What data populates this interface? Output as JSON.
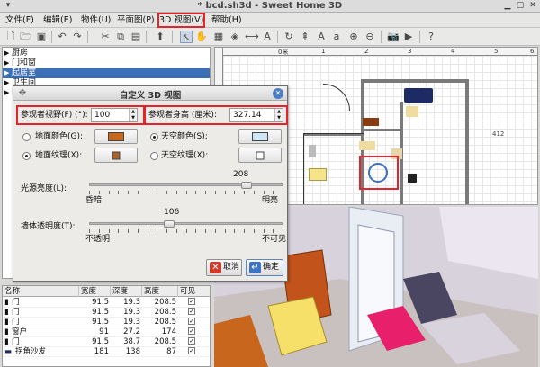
{
  "window": {
    "title": "* bcd.sh3d - Sweet Home 3D"
  },
  "menubar": {
    "items": [
      {
        "label": "文件(F)"
      },
      {
        "label": "编辑(E)"
      },
      {
        "label": "物件(U)"
      },
      {
        "label": "平面图(P)"
      },
      {
        "label": "3D 视图(V)"
      },
      {
        "label": "帮助(H)"
      }
    ]
  },
  "catalog": {
    "items": [
      {
        "label": "厨房"
      },
      {
        "label": "门和窗"
      },
      {
        "label": "起居室"
      },
      {
        "label": "卫生间"
      },
      {
        "label": "卧室"
      }
    ]
  },
  "plan": {
    "ruler_labels": [
      "0米",
      "1",
      "2",
      "3",
      "4",
      "5",
      "6"
    ],
    "dimension": "412"
  },
  "furniture_table": {
    "headers": [
      "名称",
      "宽度",
      "深度",
      "高度",
      "可见"
    ],
    "rows": [
      {
        "name": "门",
        "width": "91.5",
        "depth": "19.3",
        "height": "208.5"
      },
      {
        "name": "门",
        "width": "91.5",
        "depth": "19.3",
        "height": "208.5"
      },
      {
        "name": "门",
        "width": "91.5",
        "depth": "19.3",
        "height": "208.5"
      },
      {
        "name": "窗户",
        "width": "91",
        "depth": "27.2",
        "height": "174"
      },
      {
        "name": "门",
        "width": "91.5",
        "depth": "38.7",
        "height": "208.5"
      },
      {
        "name": "拐角沙发",
        "width": "181",
        "depth": "138",
        "height": "87"
      }
    ]
  },
  "dialog": {
    "title": "自定义 3D 视图",
    "fov_label": "参观者视野(F) (°):",
    "fov_value": "100",
    "eye_label": "参观者身高 (厘米):",
    "eye_value": "327.14",
    "ground_color_label": "地面颜色(G):",
    "ground_texture_label": "地面纹理(X):",
    "sky_color_label": "天空颜色(S):",
    "sky_texture_label": "天空纹理(X):",
    "ground_color": "#c8691f",
    "sky_color": "#cfe6f4",
    "light_label": "光源亮度(L):",
    "light_value": "208",
    "light_fraction": 0.816,
    "light_min": "昏暗",
    "light_max": "明亮",
    "wall_label": "墙体透明度(T):",
    "wall_value": "106",
    "wall_fraction": 0.416,
    "wall_min": "不透明",
    "wall_max": "不可见",
    "cancel": "取消",
    "ok": "确定"
  }
}
